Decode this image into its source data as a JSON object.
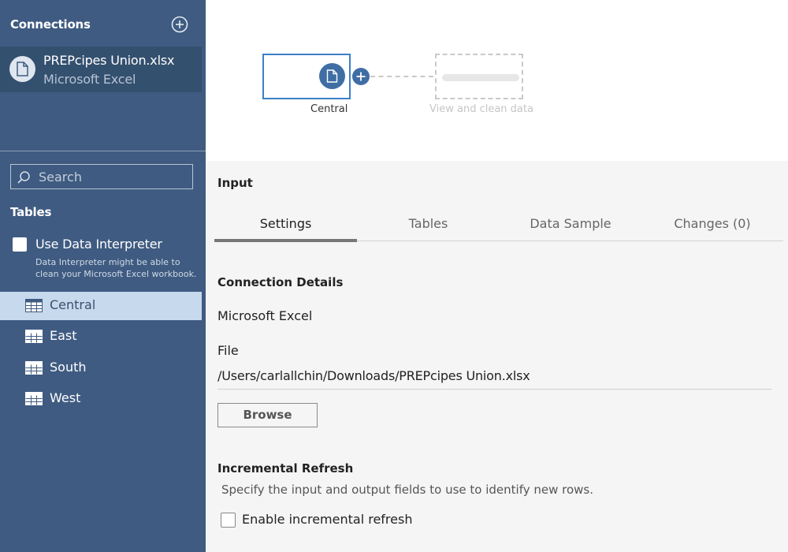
{
  "sidebar": {
    "connections_header": "Connections",
    "connection": {
      "name": "PREPcipes Union.xlsx",
      "type": "Microsoft Excel"
    },
    "search_placeholder": "Search",
    "tables_header": "Tables",
    "data_interpreter": {
      "label": "Use Data Interpreter",
      "description": "Data Interpreter might be able to clean your Microsoft Excel workbook.",
      "checked": false
    },
    "tables": [
      {
        "label": "Central",
        "selected": true
      },
      {
        "label": "East",
        "selected": false
      },
      {
        "label": "South",
        "selected": false
      },
      {
        "label": "West",
        "selected": false
      }
    ]
  },
  "flow": {
    "input_node_label": "Central",
    "placeholder_label": "View and clean data"
  },
  "panel": {
    "title": "Input",
    "tabs": [
      {
        "label": "Settings",
        "active": true
      },
      {
        "label": "Tables",
        "active": false
      },
      {
        "label": "Data Sample",
        "active": false
      },
      {
        "label": "Changes (0)",
        "active": false
      }
    ],
    "connection_details": {
      "title": "Connection Details",
      "type": "Microsoft Excel",
      "file_label": "File",
      "file_path": "/Users/carlallchin/Downloads/PREPcipes Union.xlsx",
      "browse_label": "Browse"
    },
    "incremental_refresh": {
      "title": "Incremental Refresh",
      "description": "Specify the input and output fields to use to identify new rows.",
      "checkbox_label": "Enable incremental refresh",
      "checked": false
    }
  },
  "colors": {
    "sidebar_bg": "#3f5b81",
    "selected_connection_bg": "#34506f",
    "selected_table_bg": "#c6d9ed",
    "node_accent": "#3f6ea4",
    "node_border": "#3d7fc9"
  },
  "icons": [
    "add-connection-icon",
    "document-icon",
    "search-icon",
    "table-icon",
    "plus-icon"
  ]
}
